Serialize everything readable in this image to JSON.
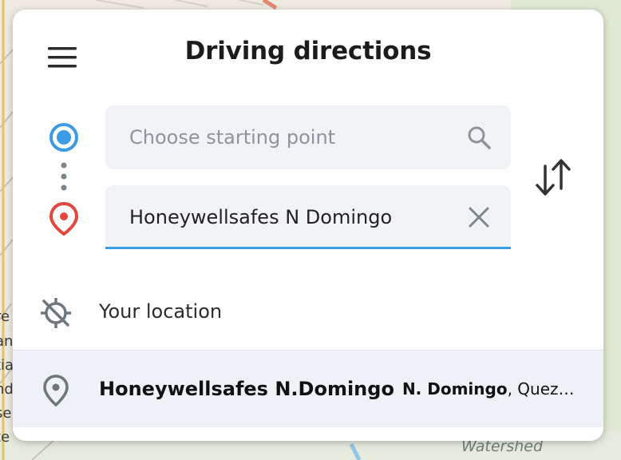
{
  "panel": {
    "title": "Driving directions",
    "menu_icon": "hamburger-icon"
  },
  "start": {
    "placeholder": "Choose starting point",
    "value": "",
    "icon": "search-icon",
    "marker_icon": "origin-circle-icon",
    "marker_color": "#3d9be6"
  },
  "destination": {
    "value": "Honeywellsafes N Domingo",
    "icon": "close-icon",
    "marker_icon": "destination-pin-icon",
    "marker_color": "#e2483d"
  },
  "swap": {
    "icon": "swap-arrows-icon"
  },
  "suggestions": [
    {
      "label": "Your location",
      "icon": "location-disabled-icon"
    },
    {
      "name": "Honeywellsafes N.Domingo",
      "sub_bold": "N. Domingo",
      "sub_rest": ", Quez…",
      "icon": "place-pin-icon"
    }
  ],
  "map": {
    "label": "Watershed",
    "edge_text": [
      "re",
      "an",
      "tia",
      "nd",
      "se",
      "te"
    ]
  },
  "colors": {
    "accent": "#3d9be6",
    "destination": "#e2483d",
    "highlight_row": "#eef1f5"
  }
}
